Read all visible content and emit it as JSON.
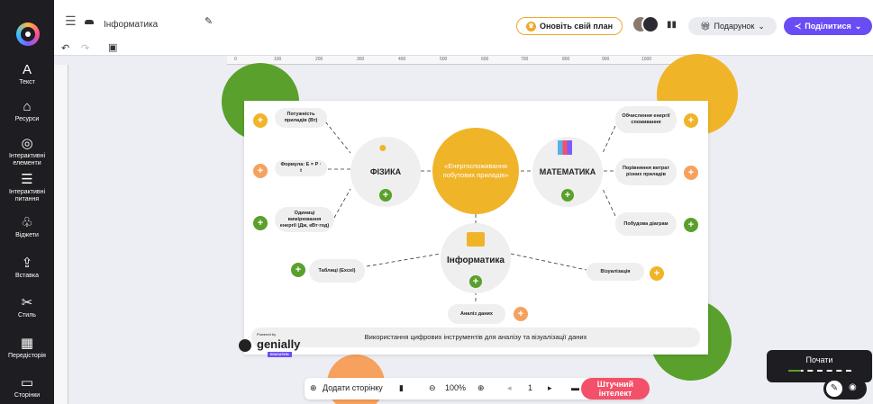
{
  "sidebar": {
    "items": [
      {
        "icon": "text-icon",
        "glyph": "A",
        "label": "Текст"
      },
      {
        "icon": "resources-icon",
        "glyph": "⌂",
        "label": "Ресурси"
      },
      {
        "icon": "interactive-elements-icon",
        "glyph": "◎",
        "label": "Інтерактивні елементи"
      },
      {
        "icon": "interactive-questions-icon",
        "glyph": "☰",
        "label": "Інтерактивні питання"
      },
      {
        "icon": "widgets-icon",
        "glyph": "♧",
        "label": "Віджети"
      },
      {
        "icon": "insert-icon",
        "glyph": "⇪",
        "label": "Вставка"
      },
      {
        "icon": "style-icon",
        "glyph": "✂",
        "label": "Стиль"
      },
      {
        "icon": "backgrounds-icon",
        "glyph": "▦",
        "label": "Передісторія"
      },
      {
        "icon": "pages-icon",
        "glyph": "▭",
        "label": "Сторінки"
      }
    ]
  },
  "topbar": {
    "title_value": "Інформатика",
    "upgrade_label": "Оновіть свій план",
    "gift_label": "Подарунок",
    "share_label": "Поділитися"
  },
  "ruler": [
    "0",
    "100",
    "200",
    "300",
    "400",
    "500",
    "600",
    "700",
    "800",
    "900",
    "1000",
    "1100"
  ],
  "slide": {
    "center": "«Енергоспоживання побутових приладів»",
    "physics": {
      "label": "ФІЗИКА",
      "subs": [
        "Потужність приладів (Вт)",
        "Формула: E = P · t",
        "Одиниці вимірювання енергії (Дж, кВт·год)"
      ]
    },
    "math": {
      "label": "МАТЕМАТИКА",
      "subs": [
        "Обчислення енергії споживання",
        "Порівняння витрат різних приладів",
        "Побудова діаграм"
      ]
    },
    "informatics": {
      "label": "Інформатика",
      "subs": [
        "Таблиці (Excel)",
        "Візуалізація",
        "Аналіз даних"
      ]
    },
    "footer": "Використання цифрових інструментів для аналізу та візуалізації даних",
    "brand": {
      "powered": "Powered by",
      "name": "genially",
      "edu": "EDUCATION"
    }
  },
  "bottom": {
    "add_page": "Додати сторінку",
    "zoom": "100%",
    "page": "1",
    "ai_label": "Штучний інтелект",
    "start_label": "Почати"
  },
  "colors": {
    "accent": "#6a4cf5",
    "yellow": "#f0b429",
    "green": "#5aa02c",
    "orange": "#f7a15e"
  }
}
